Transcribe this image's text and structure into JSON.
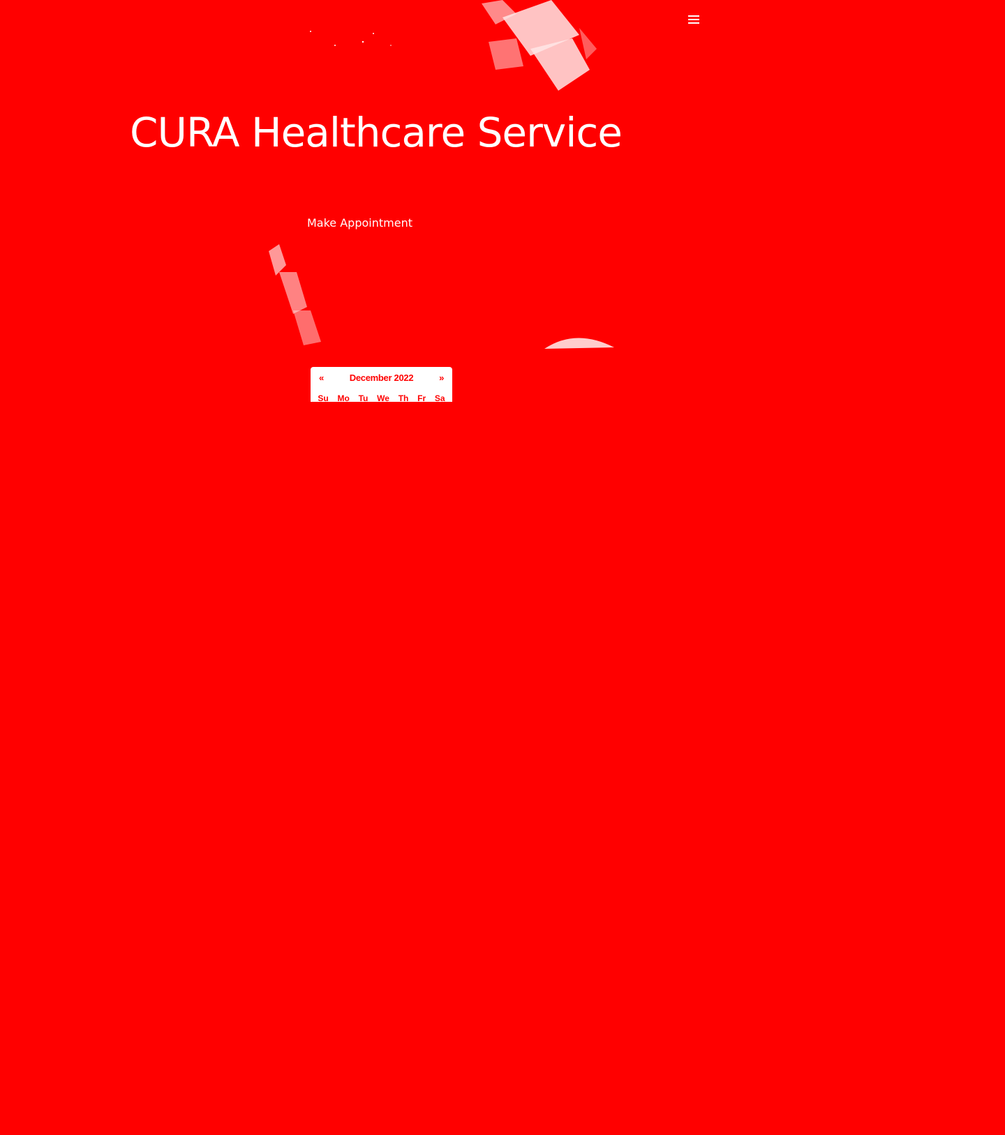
{
  "header": {
    "menu_icon": "hamburger-icon"
  },
  "hero": {
    "title": "CURA Healthcare Service",
    "appointment_label": "Make Appointment"
  },
  "datepicker": {
    "prev_label": "«",
    "month_label": "December 2022",
    "next_label": "»",
    "weekdays": [
      "Su",
      "Mo",
      "Tu",
      "We",
      "Th",
      "Fr",
      "Sa"
    ]
  },
  "colors": {
    "background": "#ff0000",
    "foreground": "#ffffff",
    "accent": "#ff0000"
  }
}
